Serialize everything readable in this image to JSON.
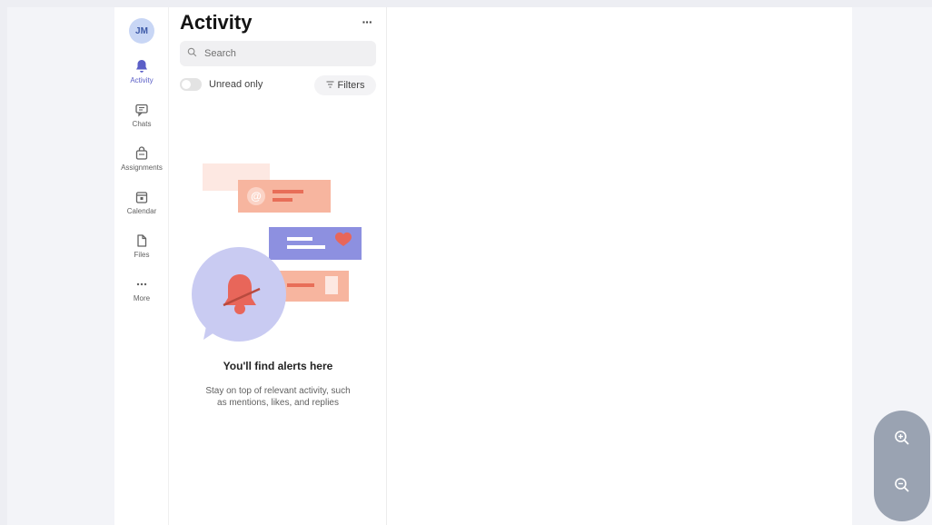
{
  "user": {
    "initials": "JM"
  },
  "rail": {
    "items": [
      {
        "label": "Activity",
        "icon": "bell-icon",
        "active": true
      },
      {
        "label": "Chats",
        "icon": "chat-icon"
      },
      {
        "label": "Assignments",
        "icon": "assignments-icon"
      },
      {
        "label": "Calendar",
        "icon": "calendar-icon"
      },
      {
        "label": "Files",
        "icon": "file-icon"
      },
      {
        "label": "More",
        "icon": "more-icon"
      }
    ]
  },
  "activity": {
    "title": "Activity",
    "more": "···",
    "search_placeholder": "Search",
    "unread_only_label": "Unread only",
    "filters_label": "Filters",
    "empty": {
      "title": "You'll find alerts here",
      "description": "Stay on top of relevant activity, such as mentions, likes, and replies"
    }
  },
  "colors": {
    "accent": "#5b5fc7",
    "coral": "#f2a58e",
    "lavender": "#8b8fe0",
    "bubble": "#c5c8f2",
    "bell": "#e8665a"
  }
}
